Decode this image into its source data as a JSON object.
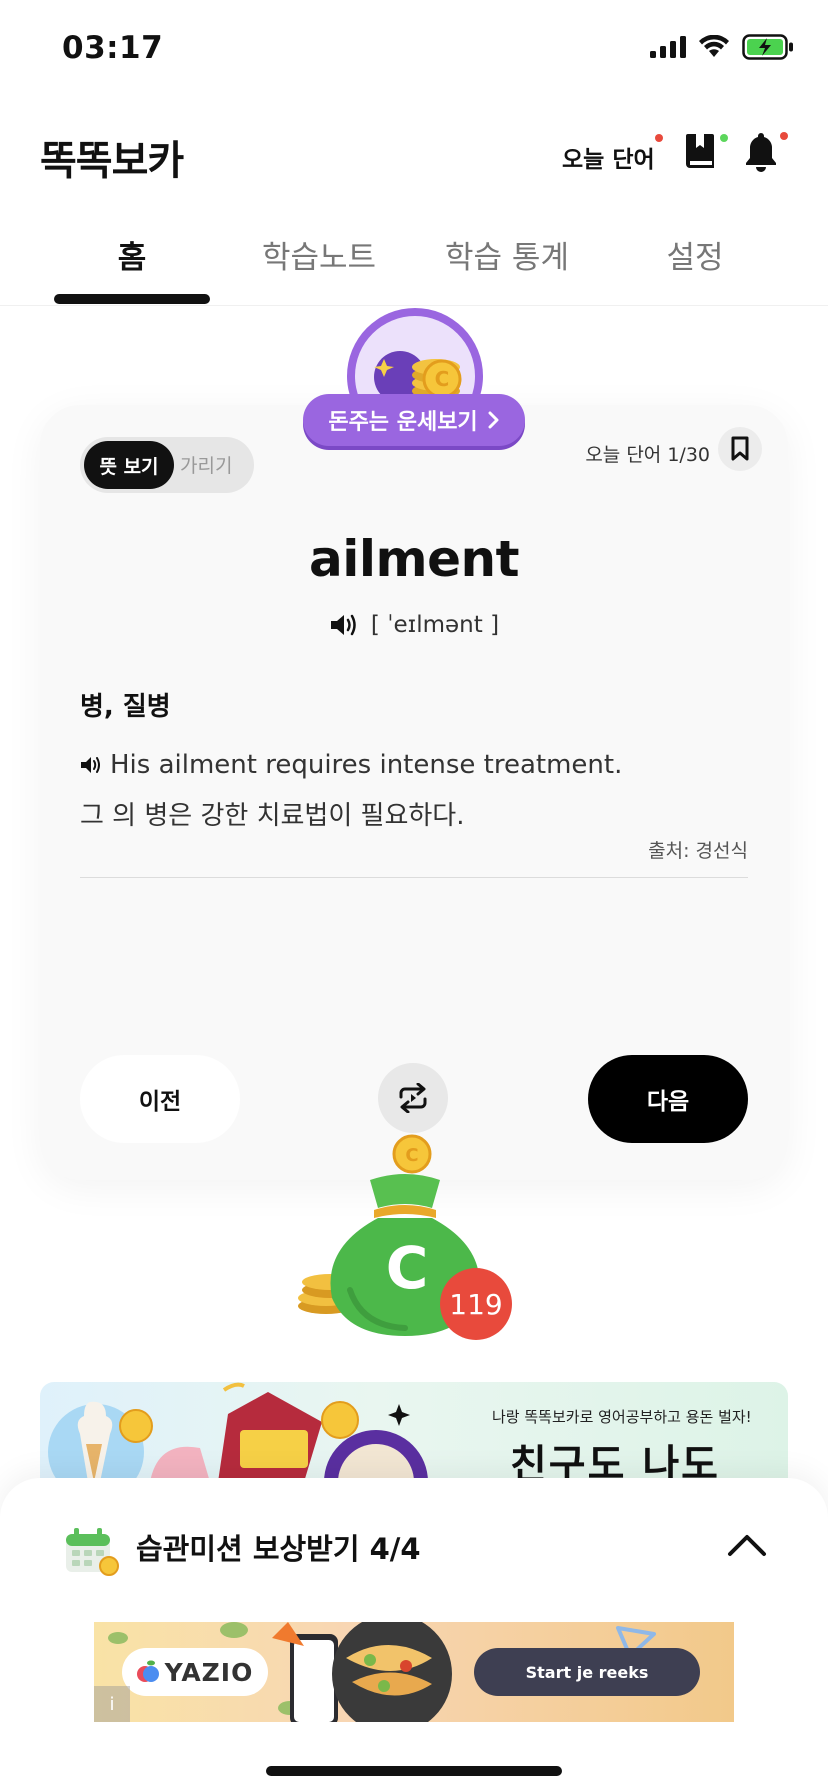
{
  "status_bar": {
    "time": "03:17"
  },
  "header": {
    "title": "똑똑보카",
    "today_word_label": "오늘 단어"
  },
  "tabs": [
    {
      "label": "홈",
      "active": true
    },
    {
      "label": "학습노트",
      "active": false
    },
    {
      "label": "학습 통계",
      "active": false
    },
    {
      "label": "설정",
      "active": false
    }
  ],
  "fortune": {
    "label": "돈주는 운세보기"
  },
  "card": {
    "toggle": {
      "show_label": "뜻 보기",
      "hide_label": "가리기"
    },
    "word_count": "오늘 단어 1/30",
    "word": "ailment",
    "pronunciation": "[ ˈeɪlmənt ]",
    "meaning": "병, 질병",
    "example_en": "His ailment requires intense treatment.",
    "example_ko": "그 의 병은 강한 치료법이 필요하다.",
    "source": "출처: 경선식",
    "prev_label": "이전",
    "next_label": "다음"
  },
  "coin_bag": {
    "count": "119",
    "letter": "C"
  },
  "banner": {
    "subtitle": "나랑 똑똑보카로 영어공부하고 용돈 벌자!",
    "title": "친구도 나도"
  },
  "mission": {
    "title": "습관미션 보상받기 4/4"
  },
  "ad": {
    "brand": "YAZIO",
    "cta": "Start je reeks",
    "info": "i"
  },
  "colors": {
    "accent_purple": "#9a66e0",
    "badge_red": "#e84a3c",
    "bag_green": "#4cb84a"
  }
}
